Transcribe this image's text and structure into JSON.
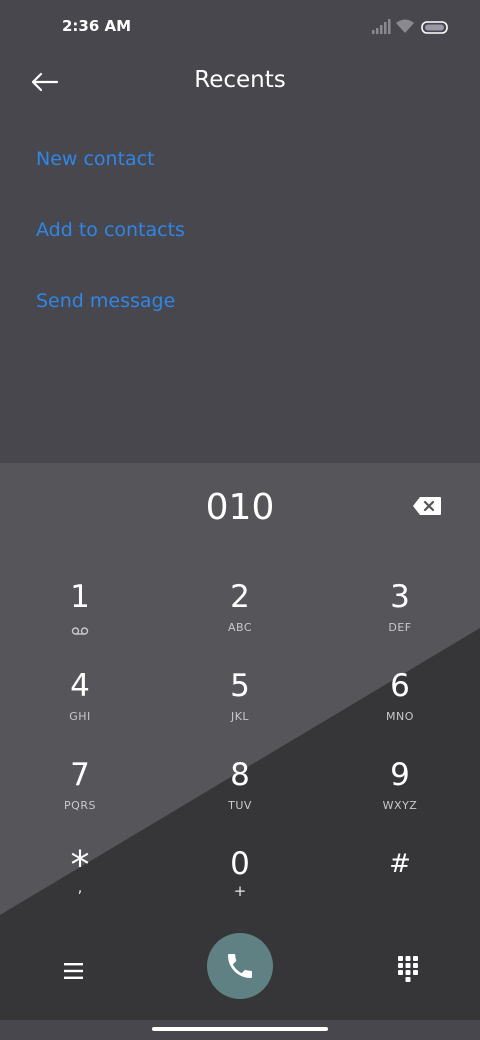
{
  "status_bar": {
    "time": "2:36 AM",
    "icons": [
      "signal-icon",
      "wifi-icon",
      "battery-icon"
    ]
  },
  "header": {
    "title": "Recents",
    "back_icon": "arrow-left-icon"
  },
  "actions": {
    "new_contact": "New contact",
    "add_to_contacts": "Add to contacts",
    "send_message": "Send message"
  },
  "dialpad": {
    "number": "010",
    "keys": [
      {
        "digit": "1",
        "letters": "",
        "icon": "voicemail-icon"
      },
      {
        "digit": "2",
        "letters": "ABC"
      },
      {
        "digit": "3",
        "letters": "DEF"
      },
      {
        "digit": "4",
        "letters": "GHI"
      },
      {
        "digit": "5",
        "letters": "JKL"
      },
      {
        "digit": "6",
        "letters": "MNO"
      },
      {
        "digit": "7",
        "letters": "PQRS"
      },
      {
        "digit": "8",
        "letters": "TUV"
      },
      {
        "digit": "9",
        "letters": "WXYZ"
      },
      {
        "digit": "*",
        "letters": ","
      },
      {
        "digit": "0",
        "letters": "+"
      },
      {
        "digit": "#",
        "letters": ""
      }
    ]
  },
  "bottom_bar": {
    "menu_icon": "menu-icon",
    "call_icon": "phone-icon",
    "dialpad_icon": "dialpad-icon"
  },
  "colors": {
    "background": "#48474e",
    "accent_link": "#2f86e6",
    "dialpad_light": "#565559",
    "dialpad_dark": "#363638",
    "call_button": "#5f8183"
  }
}
